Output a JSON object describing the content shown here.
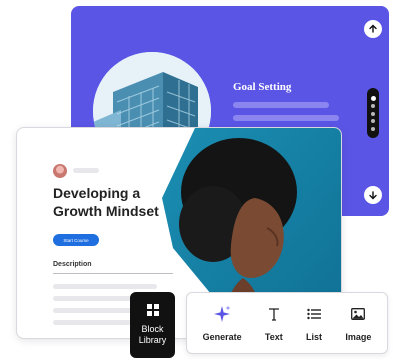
{
  "slide_back": {
    "title": "Goal Setting",
    "icons": {
      "up": "arrow-up-icon",
      "down": "arrow-down-icon"
    },
    "color": "#5b55e6",
    "pagination": {
      "total": 5,
      "active": 1
    }
  },
  "card": {
    "title": "Developing a Growth Mindset",
    "cta_label": "Start Course",
    "description_label": "Description",
    "cta_color": "#1f6fe0"
  },
  "block_library": {
    "label": "Block Library",
    "icon": "grid-icon"
  },
  "toolbar": {
    "items": [
      {
        "label": "Generate",
        "icon": "sparkle-icon"
      },
      {
        "label": "Text",
        "icon": "text-icon"
      },
      {
        "label": "List",
        "icon": "list-icon"
      },
      {
        "label": "Image",
        "icon": "image-icon"
      }
    ]
  }
}
